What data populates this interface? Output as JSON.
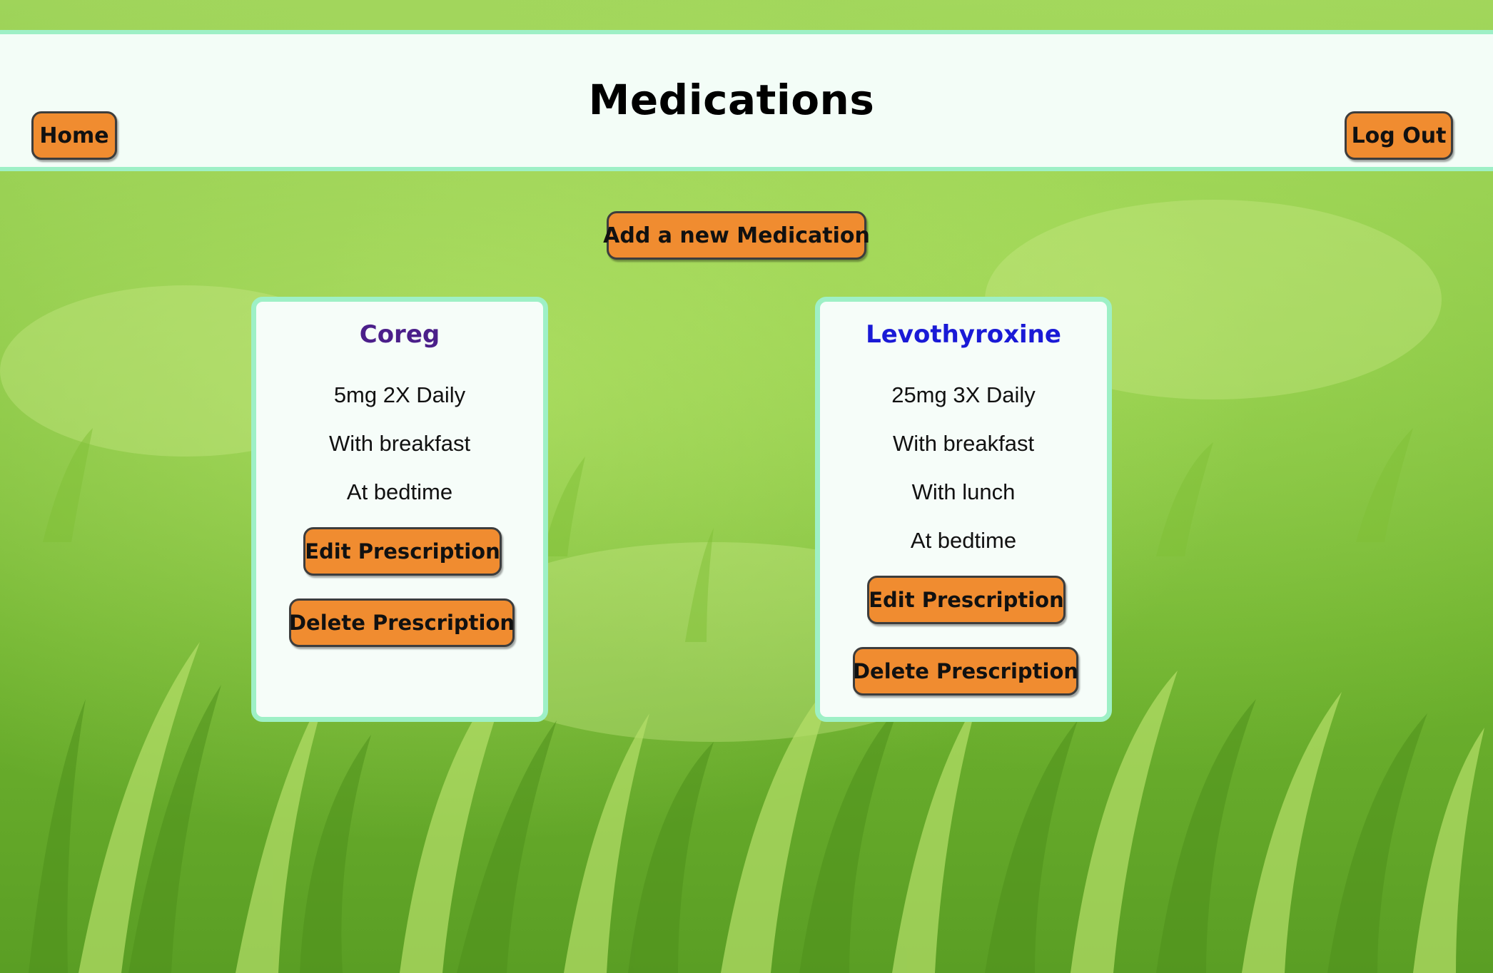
{
  "header": {
    "title": "Medications",
    "home_label": "Home",
    "logout_label": "Log Out"
  },
  "actions": {
    "add_label": "Add a new Medication"
  },
  "medications": [
    {
      "name": "Coreg",
      "name_color": "#4b1f8a",
      "dosage": "5mg 2X Daily",
      "times": [
        "With breakfast",
        "At bedtime"
      ],
      "edit_label": "Edit Prescription",
      "delete_label": "Delete Prescription"
    },
    {
      "name": "Levothyroxine",
      "name_color": "#1a1ad6",
      "dosage": "25mg 3X Daily",
      "times": [
        "With breakfast",
        "With lunch",
        "At bedtime"
      ],
      "edit_label": "Edit Prescription",
      "delete_label": "Delete Prescription"
    }
  ],
  "colors": {
    "button": "#f08c30",
    "accent_border": "#9ef0c6",
    "panel_background": "#f3fdf7"
  },
  "background_image": "grass-field"
}
